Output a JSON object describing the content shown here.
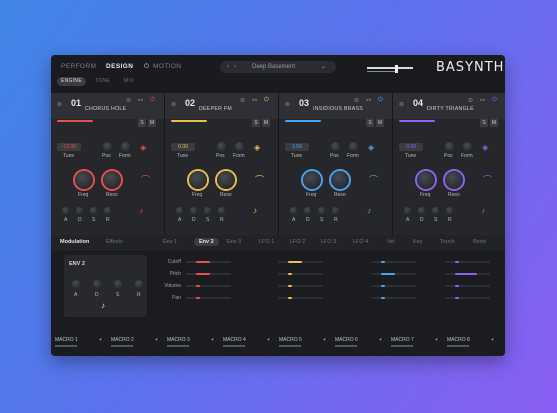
{
  "header": {
    "tabs": [
      "PERFORM",
      "DESIGN",
      "MOTION"
    ],
    "active_tab": "DESIGN",
    "subtabs": [
      "ENGINE",
      "TONE",
      "MIX"
    ],
    "active_subtab": "ENGINE",
    "preset_name": "Deep Basement",
    "logo": "BASYNTH"
  },
  "slots": [
    {
      "num": "01",
      "name": "CHORUS HOLE",
      "color": "#e8504f",
      "tune": "-12.00",
      "labels": [
        "Tune",
        "Pos",
        "Form"
      ]
    },
    {
      "num": "02",
      "name": "DEEPER FM",
      "color": "#e9c04a",
      "tune": "0.00",
      "labels": [
        "Tune",
        "Pos",
        "Form"
      ]
    },
    {
      "num": "03",
      "name": "INSIDIOUS BRASS",
      "color": "#4aa3f0",
      "tune": "3.50",
      "labels": [
        "Tune",
        "Pos",
        "Form"
      ]
    },
    {
      "num": "04",
      "name": "DIRTY TRIANGLE",
      "color": "#8f63ee",
      "tune": "0.00",
      "labels": [
        "Tune",
        "Pos",
        "Form"
      ]
    }
  ],
  "slot_common": {
    "s_label": "S",
    "m_label": "M",
    "freq_label": "Freq",
    "reso_label": "Reso",
    "adsr": [
      "A",
      "D",
      "S",
      "R"
    ]
  },
  "lower": {
    "tabs": [
      "Modulation",
      "Effects"
    ],
    "active_tab": "Modulation",
    "sources": [
      "Env 1",
      "Env 2",
      "Env 3",
      "LFO 1",
      "LFO 2",
      "LFO 3",
      "LFO 4",
      "Vel",
      "Key",
      "Touch",
      "Bend"
    ],
    "active_source": "Env 2",
    "env_title": "ENV 2",
    "targets": [
      "Cutoff",
      "Pitch",
      "Volume",
      "Pan"
    ],
    "macros": [
      "MACRO 1",
      "MACRO 2",
      "MACRO 3",
      "MACRO 4",
      "MACRO 5",
      "MACRO 6",
      "MACRO 7",
      "MACRO 8"
    ]
  }
}
